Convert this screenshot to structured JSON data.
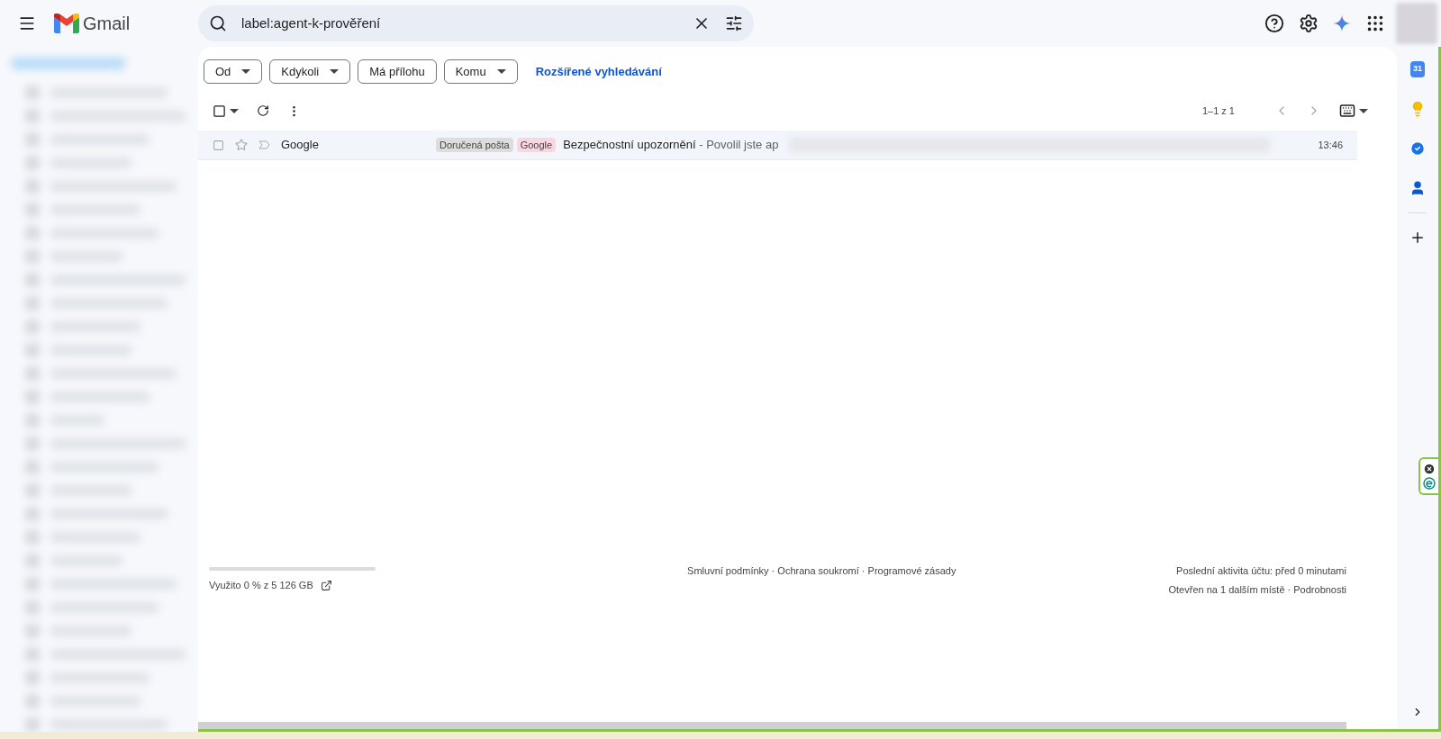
{
  "header": {
    "logo_text": "Gmail",
    "search": {
      "value": "label:agent-k-prověření"
    }
  },
  "filters": [
    {
      "label": "Od",
      "kind": "dropdown"
    },
    {
      "label": "Kdykoli",
      "kind": "dropdown"
    },
    {
      "label": "Má přílohu",
      "kind": "toggle"
    },
    {
      "label": "Komu",
      "kind": "dropdown"
    }
  ],
  "advanced_search": "Rozšířené vyhledávání",
  "select_all": {
    "checked": false
  },
  "pagination": "1–1 z 1",
  "messages": [
    {
      "sender": "Google",
      "labels": [
        {
          "text": "Doručená pošta",
          "color": "#dddddd"
        },
        {
          "text": "Google",
          "color": "#f8d7e0"
        }
      ],
      "subject": "Bezpečnostní upozornění",
      "snippet": " - Povolil jste ap",
      "time": "13:46",
      "starred": false,
      "checked": false,
      "selected": false
    }
  ],
  "footer": {
    "storage": {
      "text": "Využito 0 % z 5 126 GB"
    },
    "links": "Smluvní podmínky · Ochrana soukromí · Programové zásady",
    "activity": "Poslední aktivita účtu: před 0 minutami",
    "sessions": "Otevřen na 1 dalším místě · Podrobnosti"
  },
  "side_panel": {
    "calendar_day": "31"
  }
}
